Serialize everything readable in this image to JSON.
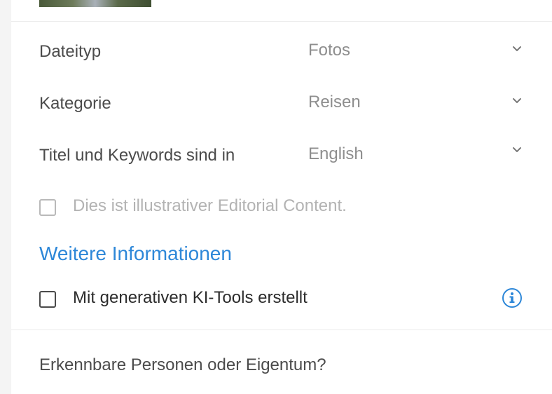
{
  "form": {
    "file_type": {
      "label": "Dateityp",
      "value": "Fotos"
    },
    "category": {
      "label": "Kategorie",
      "value": "Reisen"
    },
    "language": {
      "label": "Titel und Keywords sind in",
      "value": "English"
    },
    "editorial_checkbox": {
      "label": "Dies ist illustrativer Editorial Content.",
      "checked": false,
      "disabled": true
    },
    "more_info_link": "Weitere Informationen",
    "ai_checkbox": {
      "label": "Mit generativen KI-Tools erstellt",
      "checked": false,
      "disabled": false
    },
    "recognizable_label": "Erkennbare Personen oder Eigentum?"
  },
  "colors": {
    "link": "#2d87d8",
    "info_icon": "#2d87d8"
  },
  "icons": {
    "select_chevron": "chevron-down-icon",
    "info": "info-icon"
  }
}
